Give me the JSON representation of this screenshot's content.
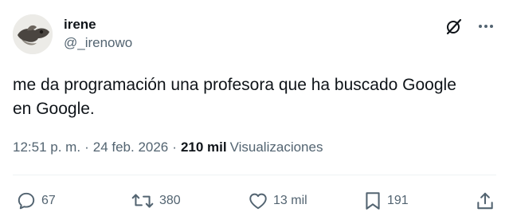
{
  "author": {
    "display_name": "irene",
    "handle": "@_irenowo"
  },
  "header": {
    "grok_icon": "grok-icon",
    "more_icon": "more-icon"
  },
  "tweet": {
    "text": "me da programación una profesora que ha buscado Google\nen Google."
  },
  "meta": {
    "time": "12:51 p. m.",
    "separator1": "·",
    "date": "24 feb. 2026",
    "separator2": "·",
    "views_count": "210 mil",
    "views_label": "Visualizaciones"
  },
  "actions": {
    "replies": {
      "icon": "reply-icon",
      "count": "67"
    },
    "retweets": {
      "icon": "retweet-icon",
      "count": "380"
    },
    "likes": {
      "icon": "heart-icon",
      "count": "13 mil"
    },
    "bookmarks": {
      "icon": "bookmark-icon",
      "count": "191"
    },
    "share": {
      "icon": "share-icon"
    }
  },
  "colors": {
    "text": "#0f1419",
    "secondary": "#536471",
    "divider": "#eff3f4",
    "background": "#ffffff"
  }
}
